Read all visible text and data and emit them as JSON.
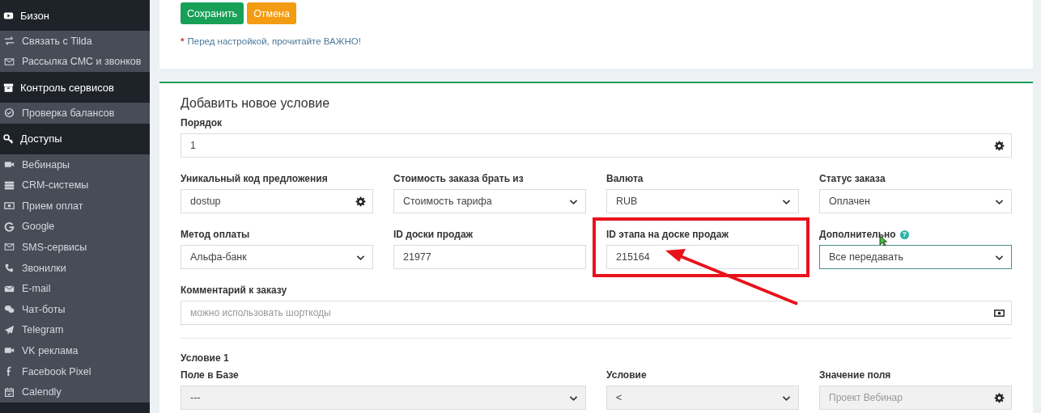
{
  "sidebar": {
    "sections": [
      {
        "kind": "header",
        "label": "Бизон"
      },
      {
        "kind": "group",
        "items": [
          {
            "label": "Связать с Tilda"
          },
          {
            "label": "Рассылка СМС и звонков"
          }
        ]
      },
      {
        "kind": "header",
        "label": "Контроль сервисов"
      },
      {
        "kind": "group",
        "items": [
          {
            "label": "Проверка балансов"
          }
        ]
      },
      {
        "kind": "header",
        "label": "Доступы"
      },
      {
        "kind": "group",
        "items": [
          {
            "label": "Вебинары"
          },
          {
            "label": "CRM-системы"
          },
          {
            "label": "Прием оплат"
          },
          {
            "label": "Google"
          },
          {
            "label": "SMS-сервисы"
          },
          {
            "label": "Звонилки"
          },
          {
            "label": "E-mail"
          },
          {
            "label": "Чат-боты"
          },
          {
            "label": "Telegram"
          },
          {
            "label": "VK реклама"
          },
          {
            "label": "Facebook Pixel"
          },
          {
            "label": "Calendly"
          }
        ]
      }
    ]
  },
  "actions": [
    {
      "label": "Сохранить",
      "kind": "primary"
    },
    {
      "label": "Отмена",
      "kind": "warning"
    }
  ],
  "note": {
    "mark": "*",
    "text": "Перед настройкой, прочитайте ВАЖНО!"
  },
  "form": {
    "title": "Добавить новое условие",
    "rows": [
      [
        {
          "label": "Порядок",
          "kind": "gear",
          "value": "1",
          "disabled": false
        }
      ],
      [
        {
          "label": "Уникальный код предложения",
          "kind": "gear",
          "value": "dostup",
          "disabled": false
        },
        {
          "label": "Стоимость заказа брать из",
          "kind": "select",
          "value": "Стоимость тарифа",
          "disabled": false
        },
        {
          "label": "Валюта",
          "kind": "select",
          "value": "RUB",
          "disabled": false
        },
        {
          "label": "Статус заказа",
          "kind": "select",
          "value": "Оплачен",
          "disabled": false
        }
      ],
      [
        {
          "label": "Метод оплаты",
          "kind": "select",
          "value": "Альфа-банк",
          "disabled": false
        },
        {
          "label": "ID доски продаж",
          "kind": "text",
          "value": "21977",
          "disabled": false
        },
        {
          "label": "ID этапа на доске продаж",
          "kind": "text",
          "value": "215164",
          "disabled": false
        },
        {
          "label": "Дополнительно",
          "kind": "select",
          "value": "Все передавать",
          "help": "?",
          "focused": true,
          "disabled": false
        }
      ],
      [
        {
          "label": "Комментарий к заказу",
          "kind": "money",
          "placeholder": "можно использовать шорткоды",
          "disabled": false
        }
      ]
    ],
    "condition": {
      "title": "Условие 1",
      "fields": [
        {
          "label": "Поле в Базе",
          "kind": "select",
          "value": "---",
          "disabled": true
        },
        {
          "label": "Условие",
          "kind": "select",
          "value": "<",
          "disabled": true
        },
        {
          "label": "Значение поля",
          "kind": "gear",
          "placeholder": "Проект Вебинар",
          "disabled": true
        }
      ]
    }
  }
}
